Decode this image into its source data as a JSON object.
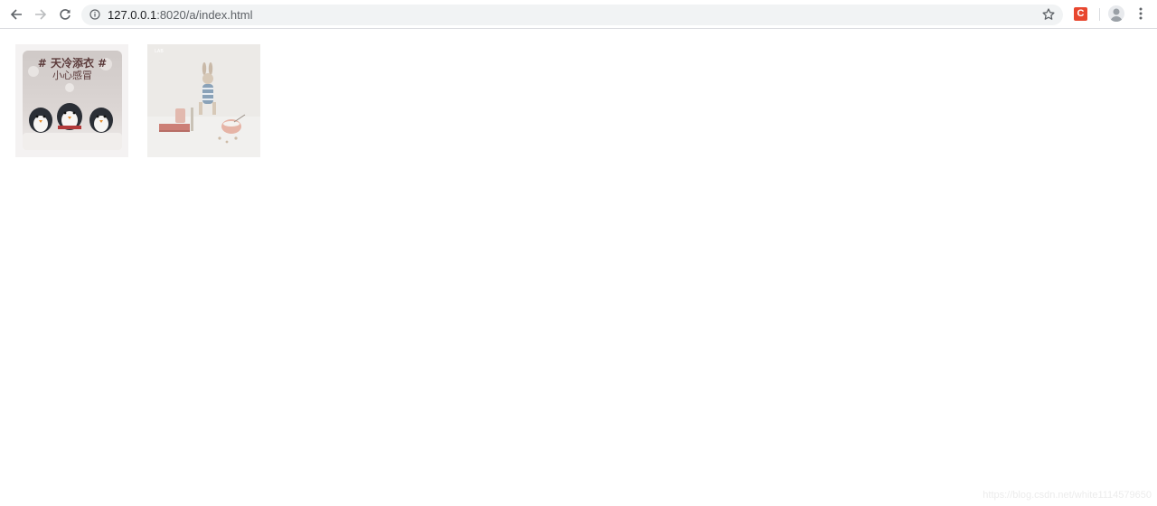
{
  "browser": {
    "url_host": "127.0.0.1",
    "url_path": ":8020/a/index.html",
    "extension_label": "C"
  },
  "images": [
    {
      "caption_line1": "# 天冷添衣 #",
      "caption_line2": "小心感冒"
    },
    {
      "label": "LAB"
    }
  ],
  "watermark": "https://blog.csdn.net/white1114579650",
  "colors": {
    "accent": "#e8472f",
    "omnibox": "#f1f3f4"
  }
}
